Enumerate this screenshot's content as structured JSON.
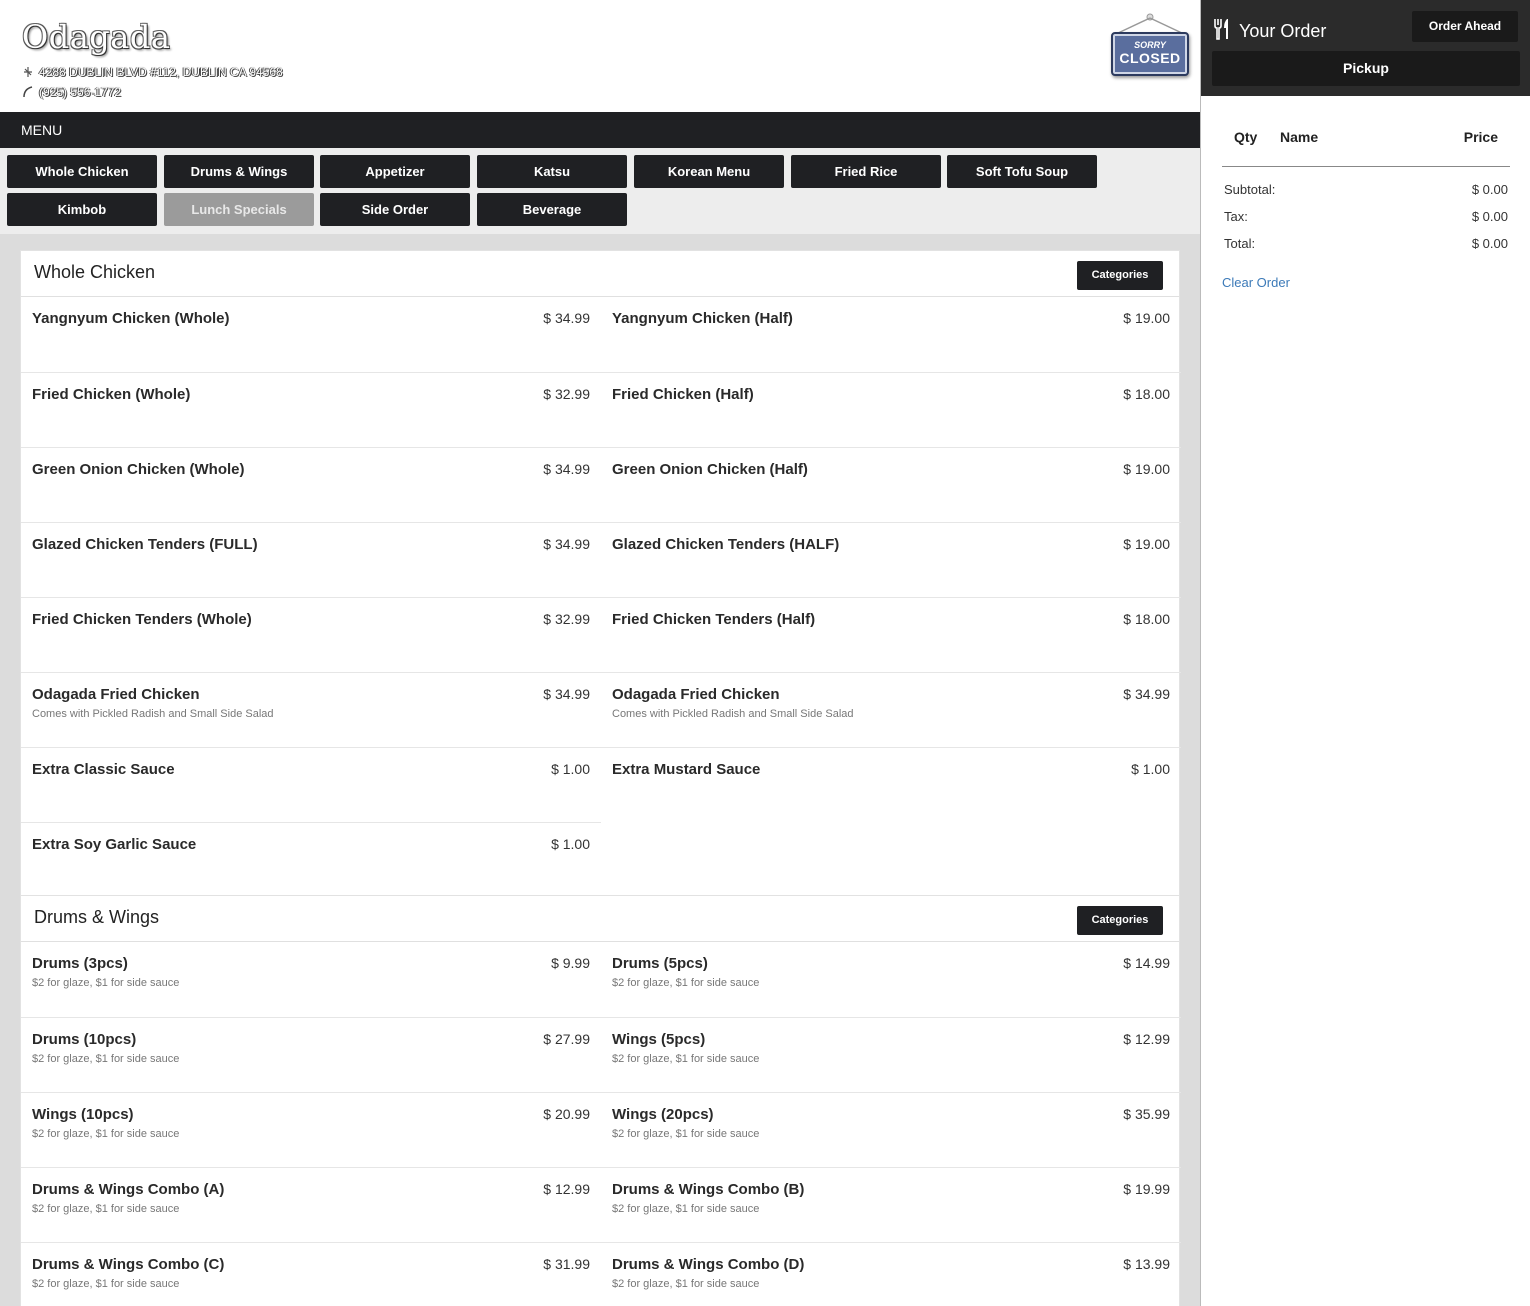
{
  "restaurant": {
    "name": "Odagada",
    "address": "4288 DUBLIN BLVD #112, DUBLIN CA 94568",
    "phone": "(925) 556-1772",
    "closed_sign": {
      "top": "SORRY",
      "bottom": "CLOSED"
    }
  },
  "menubar": {
    "label": "MENU"
  },
  "categories": [
    {
      "label": "Whole Chicken",
      "disabled": false
    },
    {
      "label": "Drums & Wings",
      "disabled": false
    },
    {
      "label": "Appetizer",
      "disabled": false
    },
    {
      "label": "Katsu",
      "disabled": false
    },
    {
      "label": "Korean Menu",
      "disabled": false
    },
    {
      "label": "Fried Rice",
      "disabled": false
    },
    {
      "label": "Soft Tofu Soup",
      "disabled": false
    },
    {
      "label": "Kimbob",
      "disabled": false
    },
    {
      "label": "Lunch Specials",
      "disabled": true
    },
    {
      "label": "Side Order",
      "disabled": false
    },
    {
      "label": "Beverage",
      "disabled": false
    }
  ],
  "sections": [
    {
      "title": "Whole Chicken",
      "categories_label": "Categories",
      "items": [
        {
          "name": "Yangnyum Chicken (Whole)",
          "price": "$ 34.99",
          "desc": ""
        },
        {
          "name": "Yangnyum Chicken (Half)",
          "price": "$ 19.00",
          "desc": ""
        },
        {
          "name": "Fried Chicken (Whole)",
          "price": "$ 32.99",
          "desc": ""
        },
        {
          "name": "Fried Chicken (Half)",
          "price": "$ 18.00",
          "desc": ""
        },
        {
          "name": "Green Onion Chicken (Whole)",
          "price": "$ 34.99",
          "desc": ""
        },
        {
          "name": "Green Onion Chicken (Half)",
          "price": "$ 19.00",
          "desc": ""
        },
        {
          "name": "Glazed Chicken Tenders (FULL)",
          "price": "$ 34.99",
          "desc": ""
        },
        {
          "name": "Glazed Chicken Tenders (HALF)",
          "price": "$ 19.00",
          "desc": ""
        },
        {
          "name": "Fried Chicken Tenders (Whole)",
          "price": "$ 32.99",
          "desc": ""
        },
        {
          "name": "Fried Chicken Tenders (Half)",
          "price": "$ 18.00",
          "desc": ""
        },
        {
          "name": "Odagada Fried Chicken",
          "price": "$ 34.99",
          "desc": "Comes with Pickled Radish and Small Side Salad"
        },
        {
          "name": "Odagada Fried Chicken",
          "price": "$ 34.99",
          "desc": "Comes with Pickled Radish and Small Side Salad"
        },
        {
          "name": "Extra Classic Sauce",
          "price": "$ 1.00",
          "desc": ""
        },
        {
          "name": "Extra Mustard Sauce",
          "price": "$ 1.00",
          "desc": ""
        },
        {
          "name": "Extra Soy Garlic Sauce",
          "price": "$ 1.00",
          "desc": ""
        }
      ]
    },
    {
      "title": "Drums & Wings",
      "categories_label": "Categories",
      "items": [
        {
          "name": "Drums (3pcs)",
          "price": "$ 9.99",
          "desc": "$2 for glaze, $1 for side sauce"
        },
        {
          "name": "Drums (5pcs)",
          "price": "$ 14.99",
          "desc": "$2 for glaze, $1 for side sauce"
        },
        {
          "name": "Drums (10pcs)",
          "price": "$ 27.99",
          "desc": "$2 for glaze, $1 for side sauce"
        },
        {
          "name": "Wings (5pcs)",
          "price": "$ 12.99",
          "desc": "$2 for glaze, $1 for side sauce"
        },
        {
          "name": "Wings (10pcs)",
          "price": "$ 20.99",
          "desc": "$2 for glaze, $1 for side sauce"
        },
        {
          "name": "Wings (20pcs)",
          "price": "$ 35.99",
          "desc": "$2 for glaze, $1 for side sauce"
        },
        {
          "name": "Drums & Wings Combo (A)",
          "price": "$ 12.99",
          "desc": "$2 for glaze, $1 for side sauce"
        },
        {
          "name": "Drums & Wings Combo (B)",
          "price": "$ 19.99",
          "desc": "$2 for glaze, $1 for side sauce"
        },
        {
          "name": "Drums & Wings Combo (C)",
          "price": "$ 31.99",
          "desc": "$2 for glaze, $1 for side sauce"
        },
        {
          "name": "Drums & Wings Combo (D)",
          "price": "$ 13.99",
          "desc": "$2 for glaze, $1 for side sauce"
        }
      ]
    }
  ],
  "order": {
    "title": "Your Order",
    "order_ahead_label": "Order Ahead",
    "pickup_label": "Pickup",
    "columns": {
      "qty": "Qty",
      "name": "Name",
      "price": "Price"
    },
    "subtotal_label": "Subtotal:",
    "subtotal_value": "$ 0.00",
    "tax_label": "Tax:",
    "tax_value": "$ 0.00",
    "total_label": "Total:",
    "total_value": "$ 0.00",
    "clear_label": "Clear Order"
  },
  "colors": {
    "dark": "#1f2023",
    "link": "#3c7ab8",
    "disabled": "#9b9b9b",
    "sign": "#5a6e9e"
  }
}
